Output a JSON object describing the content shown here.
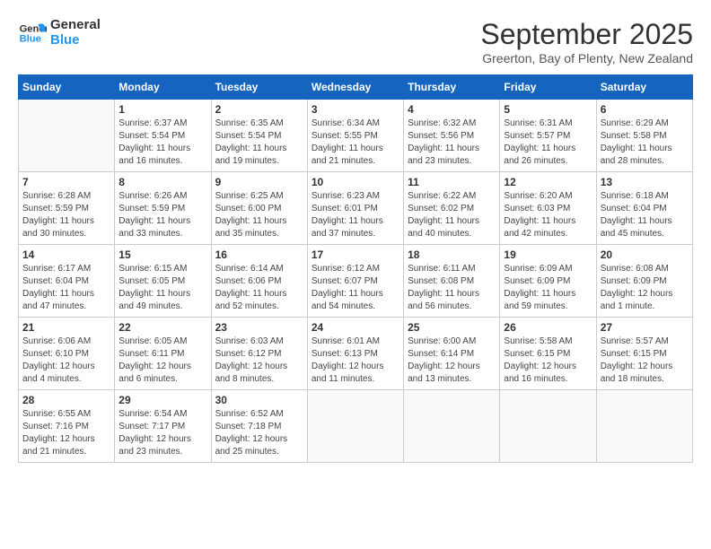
{
  "header": {
    "logo_line1": "General",
    "logo_line2": "Blue",
    "month": "September 2025",
    "location": "Greerton, Bay of Plenty, New Zealand"
  },
  "weekdays": [
    "Sunday",
    "Monday",
    "Tuesday",
    "Wednesday",
    "Thursday",
    "Friday",
    "Saturday"
  ],
  "weeks": [
    [
      {
        "day": "",
        "sunrise": "",
        "sunset": "",
        "daylight": ""
      },
      {
        "day": "1",
        "sunrise": "Sunrise: 6:37 AM",
        "sunset": "Sunset: 5:54 PM",
        "daylight": "Daylight: 11 hours and 16 minutes."
      },
      {
        "day": "2",
        "sunrise": "Sunrise: 6:35 AM",
        "sunset": "Sunset: 5:54 PM",
        "daylight": "Daylight: 11 hours and 19 minutes."
      },
      {
        "day": "3",
        "sunrise": "Sunrise: 6:34 AM",
        "sunset": "Sunset: 5:55 PM",
        "daylight": "Daylight: 11 hours and 21 minutes."
      },
      {
        "day": "4",
        "sunrise": "Sunrise: 6:32 AM",
        "sunset": "Sunset: 5:56 PM",
        "daylight": "Daylight: 11 hours and 23 minutes."
      },
      {
        "day": "5",
        "sunrise": "Sunrise: 6:31 AM",
        "sunset": "Sunset: 5:57 PM",
        "daylight": "Daylight: 11 hours and 26 minutes."
      },
      {
        "day": "6",
        "sunrise": "Sunrise: 6:29 AM",
        "sunset": "Sunset: 5:58 PM",
        "daylight": "Daylight: 11 hours and 28 minutes."
      }
    ],
    [
      {
        "day": "7",
        "sunrise": "Sunrise: 6:28 AM",
        "sunset": "Sunset: 5:59 PM",
        "daylight": "Daylight: 11 hours and 30 minutes."
      },
      {
        "day": "8",
        "sunrise": "Sunrise: 6:26 AM",
        "sunset": "Sunset: 5:59 PM",
        "daylight": "Daylight: 11 hours and 33 minutes."
      },
      {
        "day": "9",
        "sunrise": "Sunrise: 6:25 AM",
        "sunset": "Sunset: 6:00 PM",
        "daylight": "Daylight: 11 hours and 35 minutes."
      },
      {
        "day": "10",
        "sunrise": "Sunrise: 6:23 AM",
        "sunset": "Sunset: 6:01 PM",
        "daylight": "Daylight: 11 hours and 37 minutes."
      },
      {
        "day": "11",
        "sunrise": "Sunrise: 6:22 AM",
        "sunset": "Sunset: 6:02 PM",
        "daylight": "Daylight: 11 hours and 40 minutes."
      },
      {
        "day": "12",
        "sunrise": "Sunrise: 6:20 AM",
        "sunset": "Sunset: 6:03 PM",
        "daylight": "Daylight: 11 hours and 42 minutes."
      },
      {
        "day": "13",
        "sunrise": "Sunrise: 6:18 AM",
        "sunset": "Sunset: 6:04 PM",
        "daylight": "Daylight: 11 hours and 45 minutes."
      }
    ],
    [
      {
        "day": "14",
        "sunrise": "Sunrise: 6:17 AM",
        "sunset": "Sunset: 6:04 PM",
        "daylight": "Daylight: 11 hours and 47 minutes."
      },
      {
        "day": "15",
        "sunrise": "Sunrise: 6:15 AM",
        "sunset": "Sunset: 6:05 PM",
        "daylight": "Daylight: 11 hours and 49 minutes."
      },
      {
        "day": "16",
        "sunrise": "Sunrise: 6:14 AM",
        "sunset": "Sunset: 6:06 PM",
        "daylight": "Daylight: 11 hours and 52 minutes."
      },
      {
        "day": "17",
        "sunrise": "Sunrise: 6:12 AM",
        "sunset": "Sunset: 6:07 PM",
        "daylight": "Daylight: 11 hours and 54 minutes."
      },
      {
        "day": "18",
        "sunrise": "Sunrise: 6:11 AM",
        "sunset": "Sunset: 6:08 PM",
        "daylight": "Daylight: 11 hours and 56 minutes."
      },
      {
        "day": "19",
        "sunrise": "Sunrise: 6:09 AM",
        "sunset": "Sunset: 6:09 PM",
        "daylight": "Daylight: 11 hours and 59 minutes."
      },
      {
        "day": "20",
        "sunrise": "Sunrise: 6:08 AM",
        "sunset": "Sunset: 6:09 PM",
        "daylight": "Daylight: 12 hours and 1 minute."
      }
    ],
    [
      {
        "day": "21",
        "sunrise": "Sunrise: 6:06 AM",
        "sunset": "Sunset: 6:10 PM",
        "daylight": "Daylight: 12 hours and 4 minutes."
      },
      {
        "day": "22",
        "sunrise": "Sunrise: 6:05 AM",
        "sunset": "Sunset: 6:11 PM",
        "daylight": "Daylight: 12 hours and 6 minutes."
      },
      {
        "day": "23",
        "sunrise": "Sunrise: 6:03 AM",
        "sunset": "Sunset: 6:12 PM",
        "daylight": "Daylight: 12 hours and 8 minutes."
      },
      {
        "day": "24",
        "sunrise": "Sunrise: 6:01 AM",
        "sunset": "Sunset: 6:13 PM",
        "daylight": "Daylight: 12 hours and 11 minutes."
      },
      {
        "day": "25",
        "sunrise": "Sunrise: 6:00 AM",
        "sunset": "Sunset: 6:14 PM",
        "daylight": "Daylight: 12 hours and 13 minutes."
      },
      {
        "day": "26",
        "sunrise": "Sunrise: 5:58 AM",
        "sunset": "Sunset: 6:15 PM",
        "daylight": "Daylight: 12 hours and 16 minutes."
      },
      {
        "day": "27",
        "sunrise": "Sunrise: 5:57 AM",
        "sunset": "Sunset: 6:15 PM",
        "daylight": "Daylight: 12 hours and 18 minutes."
      }
    ],
    [
      {
        "day": "28",
        "sunrise": "Sunrise: 6:55 AM",
        "sunset": "Sunset: 7:16 PM",
        "daylight": "Daylight: 12 hours and 21 minutes."
      },
      {
        "day": "29",
        "sunrise": "Sunrise: 6:54 AM",
        "sunset": "Sunset: 7:17 PM",
        "daylight": "Daylight: 12 hours and 23 minutes."
      },
      {
        "day": "30",
        "sunrise": "Sunrise: 6:52 AM",
        "sunset": "Sunset: 7:18 PM",
        "daylight": "Daylight: 12 hours and 25 minutes."
      },
      {
        "day": "",
        "sunrise": "",
        "sunset": "",
        "daylight": ""
      },
      {
        "day": "",
        "sunrise": "",
        "sunset": "",
        "daylight": ""
      },
      {
        "day": "",
        "sunrise": "",
        "sunset": "",
        "daylight": ""
      },
      {
        "day": "",
        "sunrise": "",
        "sunset": "",
        "daylight": ""
      }
    ]
  ]
}
